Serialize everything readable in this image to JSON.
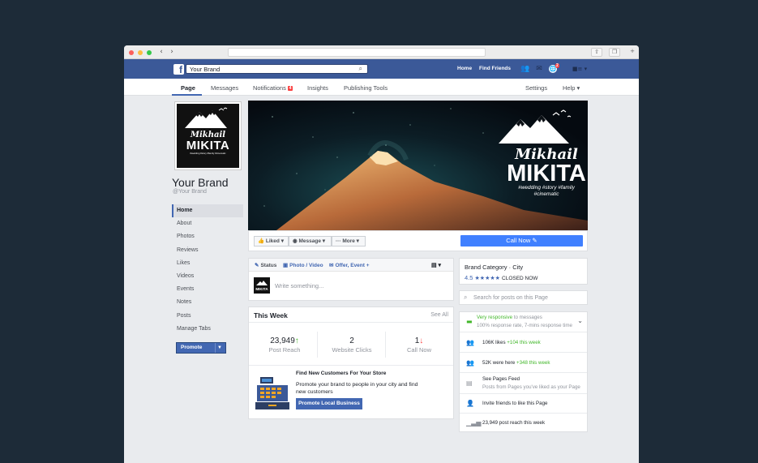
{
  "browser": {
    "share_icon": "share-icon",
    "tabs_icon": "tabs-icon",
    "plus": "+"
  },
  "topbar": {
    "search_value": "Your Brand",
    "home": "Home",
    "find_friends": "Find Friends",
    "notif_count": "2"
  },
  "tabs": {
    "page": "Page",
    "messages": "Messages",
    "notifications": "Notifications",
    "notifications_count": "4",
    "insights": "Insights",
    "publishing_tools": "Publishing Tools",
    "settings": "Settings",
    "help": "Help"
  },
  "profile": {
    "logo_line1": "Mikhail",
    "logo_line2": "MIKITA",
    "logo_tagline": "#wedding #story #family #cinematic",
    "name": "Your Brand",
    "handle": "@Your Brand"
  },
  "sidenav": [
    "Home",
    "About",
    "Photos",
    "Reviews",
    "Likes",
    "Videos",
    "Events",
    "Notes",
    "Posts",
    "Manage Tabs"
  ],
  "promote": "Promote",
  "cover": {
    "line1": "Mikhail",
    "line2": "MIKITA",
    "tagline": "#wedding #story #family #cinematic"
  },
  "actions": {
    "liked": "Liked",
    "message": "Message",
    "more": "More",
    "call_now": "Call Now"
  },
  "composer": {
    "status": "Status",
    "photo_video": "Photo / Video",
    "offer_event": "Offer, Event +",
    "placeholder": "Write something..."
  },
  "this_week": {
    "title": "This Week",
    "see_all": "See All",
    "stats": [
      {
        "value": "23,949",
        "arrow": "↑",
        "label": "Post Reach"
      },
      {
        "value": "2",
        "arrow": "",
        "label": "Website Clicks"
      },
      {
        "value": "1",
        "arrow": "↓",
        "label": "Call Now"
      }
    ],
    "promo_title": "Find New Customers For Your Store",
    "promo_text": "Promote your brand to people in your city and find new customers",
    "promo_button": "Promote Local Business"
  },
  "about": {
    "category": "Brand Category",
    "city": "City",
    "rating": "4.5",
    "status": "CLOSED NOW",
    "search_placeholder": "Search for posts on this Page",
    "responsive": "Very responsive",
    "responsive_suffix": "to messages",
    "response_rate": "100% response rate, 7-mins response time",
    "likes": "106K likes",
    "likes_delta": "+104 this week",
    "visits": "52K were here",
    "visits_delta": "+348 this week",
    "feed_title": "See Pages Feed",
    "feed_sub": "Posts from Pages you've liked as your Page",
    "invite": "Invite friends to like this Page",
    "reach": "23,949 post reach this week"
  }
}
